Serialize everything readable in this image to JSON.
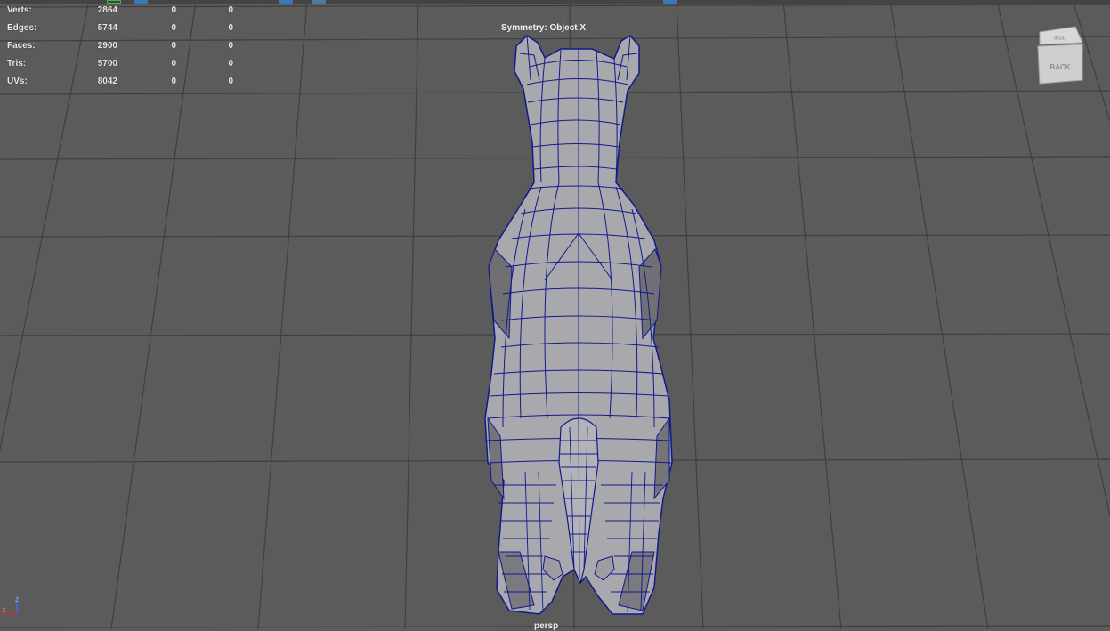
{
  "hud": {
    "rows": [
      {
        "label": "Verts:",
        "total": "2864",
        "selected": "0",
        "component": "0"
      },
      {
        "label": "Edges:",
        "total": "5744",
        "selected": "0",
        "component": "0"
      },
      {
        "label": "Faces:",
        "total": "2900",
        "selected": "0",
        "component": "0"
      },
      {
        "label": "Tris:",
        "total": "5700",
        "selected": "0",
        "component": "0"
      },
      {
        "label": "UVs:",
        "total": "8042",
        "selected": "0",
        "component": "0"
      }
    ]
  },
  "viewport": {
    "symmetry": "Symmetry: Object X",
    "camera": "persp",
    "background_color": "#5b5b5b",
    "grid_color": "#3e3e3e",
    "wire_color": "#101a8c",
    "mesh_color": "#a9a9ad"
  },
  "view_cube": {
    "front_face": "BACK",
    "top_face": "TOP",
    "icon": "view-cube-icon"
  },
  "axis_gizmo": {
    "labels": [
      "Z",
      "X"
    ],
    "icon": "axis-gizmo-icon"
  }
}
